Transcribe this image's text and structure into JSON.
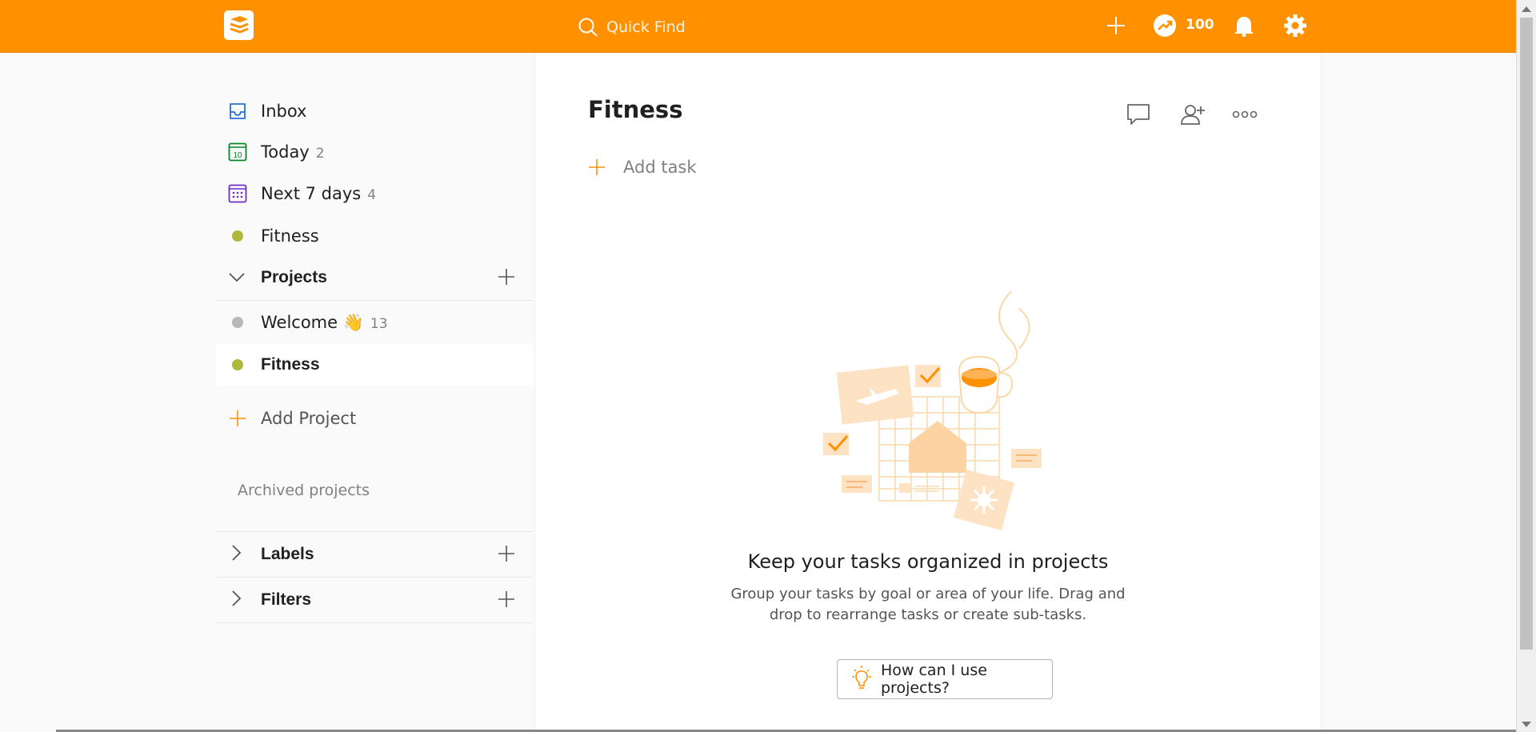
{
  "topbar": {
    "search_placeholder": "Quick Find",
    "karma_value": "100"
  },
  "sidebar": {
    "items": [
      {
        "label": "Inbox",
        "count": "",
        "icon": "inbox-icon"
      },
      {
        "label": "Today",
        "count": "2",
        "icon": "calendar-today-icon"
      },
      {
        "label": "Next 7 days",
        "count": "4",
        "icon": "calendar-week-icon"
      },
      {
        "label": "Fitness",
        "count": "",
        "icon": "project-dot-icon"
      }
    ],
    "projects_title": "Projects",
    "projects": [
      {
        "label": "Welcome 👋",
        "count": "13",
        "color": "#b8b8b8"
      },
      {
        "label": "Fitness",
        "count": "",
        "color": "#afb83b"
      }
    ],
    "add_project_label": "Add Project",
    "archived_label": "Archived projects",
    "labels_title": "Labels",
    "filters_title": "Filters"
  },
  "main": {
    "title": "Fitness",
    "add_task_label": "Add task",
    "empty_title": "Keep your tasks organized in projects",
    "empty_desc": "Group your tasks by goal or area of your life. Drag and drop to rearrange tasks or create sub-tasks.",
    "help_button_label": "How can I use projects?"
  },
  "colors": {
    "accent": "#ff9000",
    "fitness_dot": "#afb83b",
    "welcome_dot": "#b8b8b8"
  }
}
